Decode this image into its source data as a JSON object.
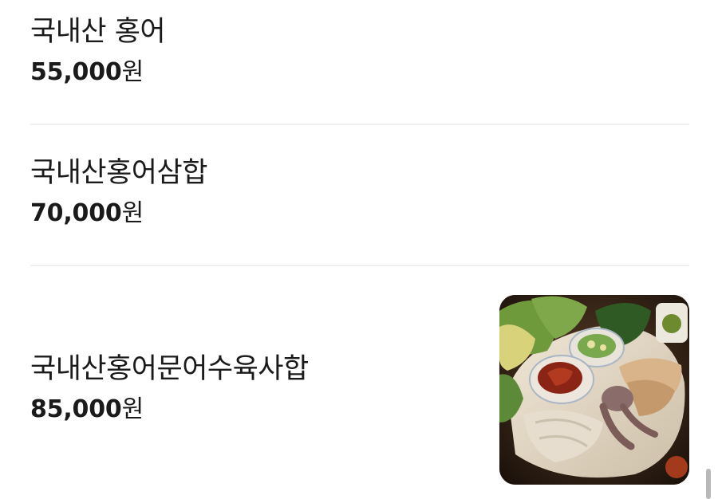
{
  "menu": {
    "items": [
      {
        "name": "국내산 홍어",
        "price": "55,000",
        "currency": "원"
      },
      {
        "name": "국내산홍어삼합",
        "price": "70,000",
        "currency": "원"
      },
      {
        "name": "국내산홍어문어수육사합",
        "price": "85,000",
        "currency": "원"
      }
    ]
  }
}
